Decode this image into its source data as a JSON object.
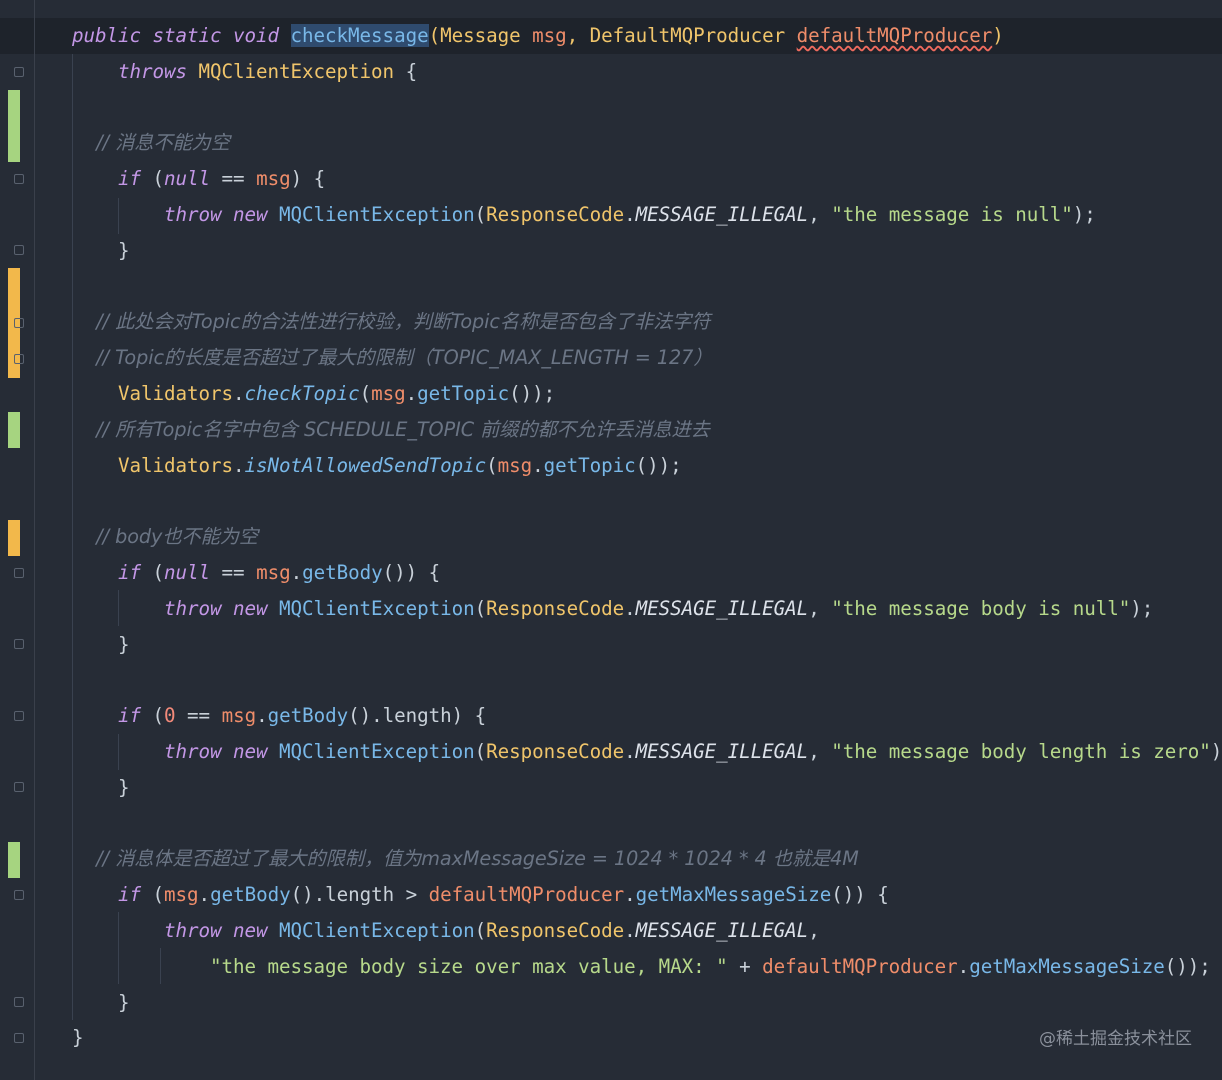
{
  "colors": {
    "background": "#262c36",
    "keyword": "#c397e6",
    "type": "#f0c56b",
    "param": "#ef8d6a",
    "method": "#79b8e8",
    "string": "#b7d98b",
    "comment": "#6b7585",
    "change_added": "#a6d480",
    "change_modified": "#f2b84b"
  },
  "lines": [
    {
      "k": "highlight",
      "t": [
        [
          "kw",
          "public static void "
        ],
        [
          "sel",
          "checkMessage"
        ],
        [
          "type",
          "(Message "
        ],
        [
          "param",
          "msg"
        ],
        [
          "type",
          ", DefaultMQProducer "
        ],
        [
          "param squiggle",
          "defaultMQProducer"
        ],
        [
          "type",
          ")"
        ]
      ]
    },
    {
      "t": [
        [
          "kw",
          "    throws "
        ],
        [
          "type",
          "MQClientException "
        ],
        [
          "punct",
          "{"
        ]
      ]
    },
    {
      "t": []
    },
    {
      "t": [
        [
          "comment",
          "    // 消息不能为空"
        ]
      ]
    },
    {
      "t": [
        [
          "kw",
          "    if "
        ],
        [
          "punct",
          "("
        ],
        [
          "nullkw",
          "null"
        ],
        [
          "punct",
          " == "
        ],
        [
          "param",
          "msg"
        ],
        [
          "punct",
          ") {"
        ]
      ]
    },
    {
      "t": [
        [
          "kw",
          "        throw new "
        ],
        [
          "klass",
          "MQClientException"
        ],
        [
          "punct",
          "("
        ],
        [
          "type",
          "ResponseCode"
        ],
        [
          "punct",
          "."
        ],
        [
          "const",
          "MESSAGE_ILLEGAL"
        ],
        [
          "punct",
          ", "
        ],
        [
          "str",
          "\"the message is null\""
        ],
        [
          "punct",
          ");"
        ]
      ]
    },
    {
      "t": [
        [
          "punct",
          "    }"
        ]
      ]
    },
    {
      "t": []
    },
    {
      "t": [
        [
          "comment",
          "    // 此处会对Topic的合法性进行校验，判断Topic名称是否包含了非法字符"
        ]
      ]
    },
    {
      "t": [
        [
          "comment",
          "    // Topic的长度是否超过了最大的限制（TOPIC_MAX_LENGTH = 127）"
        ]
      ]
    },
    {
      "t": [
        [
          "type",
          "    Validators"
        ],
        [
          "punct",
          "."
        ],
        [
          "fn-italic",
          "checkTopic"
        ],
        [
          "punct",
          "("
        ],
        [
          "param",
          "msg"
        ],
        [
          "punct",
          "."
        ],
        [
          "method",
          "getTopic"
        ],
        [
          "punct",
          "());"
        ]
      ]
    },
    {
      "t": [
        [
          "comment",
          "    // 所有Topic名字中包含 SCHEDULE_TOPIC 前缀的都不允许丢消息进去"
        ]
      ]
    },
    {
      "t": [
        [
          "type",
          "    Validators"
        ],
        [
          "punct",
          "."
        ],
        [
          "fn-italic",
          "isNotAllowedSendTopic"
        ],
        [
          "punct",
          "("
        ],
        [
          "param",
          "msg"
        ],
        [
          "punct",
          "."
        ],
        [
          "method",
          "getTopic"
        ],
        [
          "punct",
          "());"
        ]
      ]
    },
    {
      "t": []
    },
    {
      "t": [
        [
          "comment",
          "    // body也不能为空"
        ]
      ]
    },
    {
      "t": [
        [
          "kw",
          "    if "
        ],
        [
          "punct",
          "("
        ],
        [
          "nullkw",
          "null"
        ],
        [
          "punct",
          " == "
        ],
        [
          "param",
          "msg"
        ],
        [
          "punct",
          "."
        ],
        [
          "method",
          "getBody"
        ],
        [
          "punct",
          "()) {"
        ]
      ]
    },
    {
      "t": [
        [
          "kw",
          "        throw new "
        ],
        [
          "klass",
          "MQClientException"
        ],
        [
          "punct",
          "("
        ],
        [
          "type",
          "ResponseCode"
        ],
        [
          "punct",
          "."
        ],
        [
          "const",
          "MESSAGE_ILLEGAL"
        ],
        [
          "punct",
          ", "
        ],
        [
          "str",
          "\"the message body is null\""
        ],
        [
          "punct",
          ");"
        ]
      ]
    },
    {
      "t": [
        [
          "punct",
          "    }"
        ]
      ]
    },
    {
      "t": []
    },
    {
      "t": [
        [
          "kw",
          "    if "
        ],
        [
          "punct",
          "("
        ],
        [
          "num",
          "0"
        ],
        [
          "punct",
          " == "
        ],
        [
          "param",
          "msg"
        ],
        [
          "punct",
          "."
        ],
        [
          "method",
          "getBody"
        ],
        [
          "punct",
          "().length) {"
        ]
      ]
    },
    {
      "t": [
        [
          "kw",
          "        throw new "
        ],
        [
          "klass",
          "MQClientException"
        ],
        [
          "punct",
          "("
        ],
        [
          "type",
          "ResponseCode"
        ],
        [
          "punct",
          "."
        ],
        [
          "const",
          "MESSAGE_ILLEGAL"
        ],
        [
          "punct",
          ", "
        ],
        [
          "str",
          "\"the message body length is zero\""
        ],
        [
          "punct",
          ");"
        ]
      ]
    },
    {
      "t": [
        [
          "punct",
          "    }"
        ]
      ]
    },
    {
      "t": []
    },
    {
      "t": [
        [
          "comment",
          "    // 消息体是否超过了最大的限制，值为maxMessageSize = 1024 * 1024 * 4 也就是4M"
        ]
      ]
    },
    {
      "t": [
        [
          "kw",
          "    if "
        ],
        [
          "punct",
          "("
        ],
        [
          "param",
          "msg"
        ],
        [
          "punct",
          "."
        ],
        [
          "method",
          "getBody"
        ],
        [
          "punct",
          "().length > "
        ],
        [
          "param",
          "defaultMQProducer"
        ],
        [
          "punct",
          "."
        ],
        [
          "method",
          "getMaxMessageSize"
        ],
        [
          "punct",
          "()) {"
        ]
      ]
    },
    {
      "t": [
        [
          "kw",
          "        throw new "
        ],
        [
          "klass",
          "MQClientException"
        ],
        [
          "punct",
          "("
        ],
        [
          "type",
          "ResponseCode"
        ],
        [
          "punct",
          "."
        ],
        [
          "const",
          "MESSAGE_ILLEGAL"
        ],
        [
          "punct",
          ","
        ]
      ]
    },
    {
      "t": [
        [
          "str",
          "            \"the message body size over max value, MAX: \""
        ],
        [
          "punct",
          " + "
        ],
        [
          "param",
          "defaultMQProducer"
        ],
        [
          "punct",
          "."
        ],
        [
          "method",
          "getMaxMessageSize"
        ],
        [
          "punct",
          "());"
        ]
      ]
    },
    {
      "t": [
        [
          "punct",
          "    }"
        ]
      ]
    },
    {
      "t": [
        [
          "punct",
          "}"
        ]
      ]
    }
  ],
  "watermark": "@稀土掘金技术社区"
}
